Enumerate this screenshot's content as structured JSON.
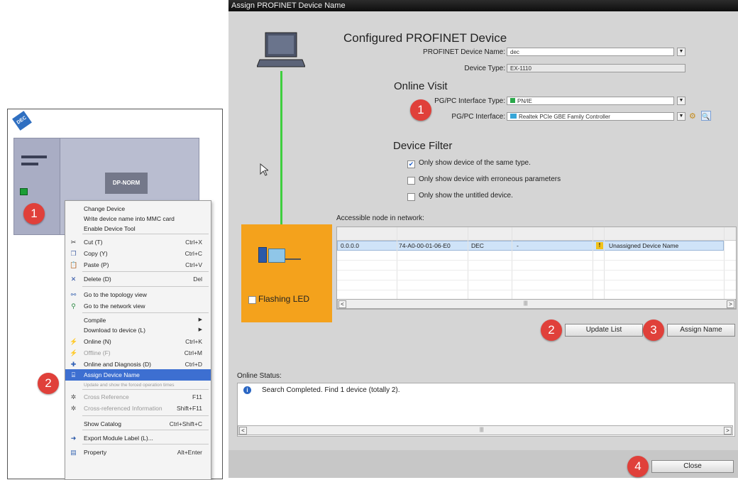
{
  "left": {
    "device_tag": "DEC",
    "device_label": "DP-NORM",
    "badge1": "1",
    "badge2": "2",
    "menu": [
      {
        "label": "Change Device",
        "shortcut": "",
        "disabled": false,
        "icon": ""
      },
      {
        "label": "Write device name into MMC card",
        "shortcut": "",
        "disabled": false,
        "icon": ""
      },
      {
        "label": "Enable Device Tool",
        "shortcut": "",
        "disabled": false,
        "icon": ""
      },
      {
        "label": "Cut (T)",
        "shortcut": "Ctrl+X",
        "disabled": false,
        "icon": "cut-icon"
      },
      {
        "label": "Copy (Y)",
        "shortcut": "Ctrl+C",
        "disabled": false,
        "icon": "copy-icon"
      },
      {
        "label": "Paste (P)",
        "shortcut": "Ctrl+V",
        "disabled": false,
        "icon": "paste-icon"
      },
      {
        "label": "Delete (D)",
        "shortcut": "Del",
        "disabled": false,
        "icon": "delete-icon"
      },
      {
        "label": "Go to the topology view",
        "shortcut": "",
        "disabled": false,
        "icon": "topology-icon"
      },
      {
        "label": "Go to the network view",
        "shortcut": "",
        "disabled": false,
        "icon": "network-icon"
      },
      {
        "label": "Compile",
        "shortcut": "▶",
        "disabled": false,
        "icon": ""
      },
      {
        "label": "Download to device (L)",
        "shortcut": "▶",
        "disabled": false,
        "icon": ""
      },
      {
        "label": "Online (N)",
        "shortcut": "Ctrl+K",
        "disabled": false,
        "icon": "online-icon"
      },
      {
        "label": "Offline (F)",
        "shortcut": "Ctrl+M",
        "disabled": true,
        "icon": "offline-icon"
      },
      {
        "label": "Online and Diagnosis (D)",
        "shortcut": "Ctrl+D",
        "disabled": false,
        "icon": "diagnosis-icon"
      },
      {
        "label": "Assign Device Name",
        "shortcut": "",
        "disabled": false,
        "icon": "assign-name-icon"
      },
      {
        "label": "Update and show the forced operation times",
        "shortcut": "",
        "disabled": true,
        "icon": ""
      },
      {
        "label": "Cross Reference",
        "shortcut": "F11",
        "disabled": true,
        "icon": "cross-reference-icon"
      },
      {
        "label": "Cross-referenced Information",
        "shortcut": "Shift+F11",
        "disabled": true,
        "icon": "cross-info-icon"
      },
      {
        "label": "Show Catalog",
        "shortcut": "Ctrl+Shift+C",
        "disabled": false,
        "icon": ""
      },
      {
        "label": "Export Module Label (L)...",
        "shortcut": "",
        "disabled": false,
        "icon": "export-icon"
      },
      {
        "label": "Property",
        "shortcut": "Alt+Enter",
        "disabled": false,
        "icon": "property-icon"
      }
    ]
  },
  "dialog": {
    "title": "Assign PROFINET Device Name",
    "configured_heading": "Configured PROFINET Device",
    "device_name_label": "PROFINET Device Name:",
    "device_name_value": "dec",
    "device_type_label": "Device Type:",
    "device_type_value": "EX-1110",
    "online_heading": "Online Visit",
    "iface_type_label": "PG/PC Interface Type:",
    "iface_type_value": "PN/IE",
    "iface_label": "PG/PC Interface:",
    "iface_value": "Realtek PCIe GBE Family Controller",
    "filter_heading": "Device Filter",
    "filters": [
      {
        "label": "Only show device of the same type.",
        "checked": true
      },
      {
        "label": "Only show device with erroneous parameters",
        "checked": false
      },
      {
        "label": "Only show the untitled device.",
        "checked": false
      }
    ],
    "nodes_label": "Accessible node in network:",
    "node_row": {
      "ip": "0.0.0.0",
      "mac": "74-A0-00-01-06-E0",
      "type": "DEC",
      "name": "-",
      "status": "Unassigned Device Name"
    },
    "flash_led_label": "Flashing LED",
    "update_button": "Update List",
    "assign_button": "Assign Name",
    "online_status_label": "Online Status:",
    "status_message": "Search Completed. Find 1 device (totally 2).",
    "close_button": "Close",
    "badges": {
      "b1": "1",
      "b2": "2",
      "b3": "3",
      "b4": "4"
    }
  },
  "colors": {
    "accent_red": "#e0403a",
    "selection_blue": "#3d6fd1",
    "link_green": "#3fcf3f",
    "led_orange": "#f4a21c"
  }
}
